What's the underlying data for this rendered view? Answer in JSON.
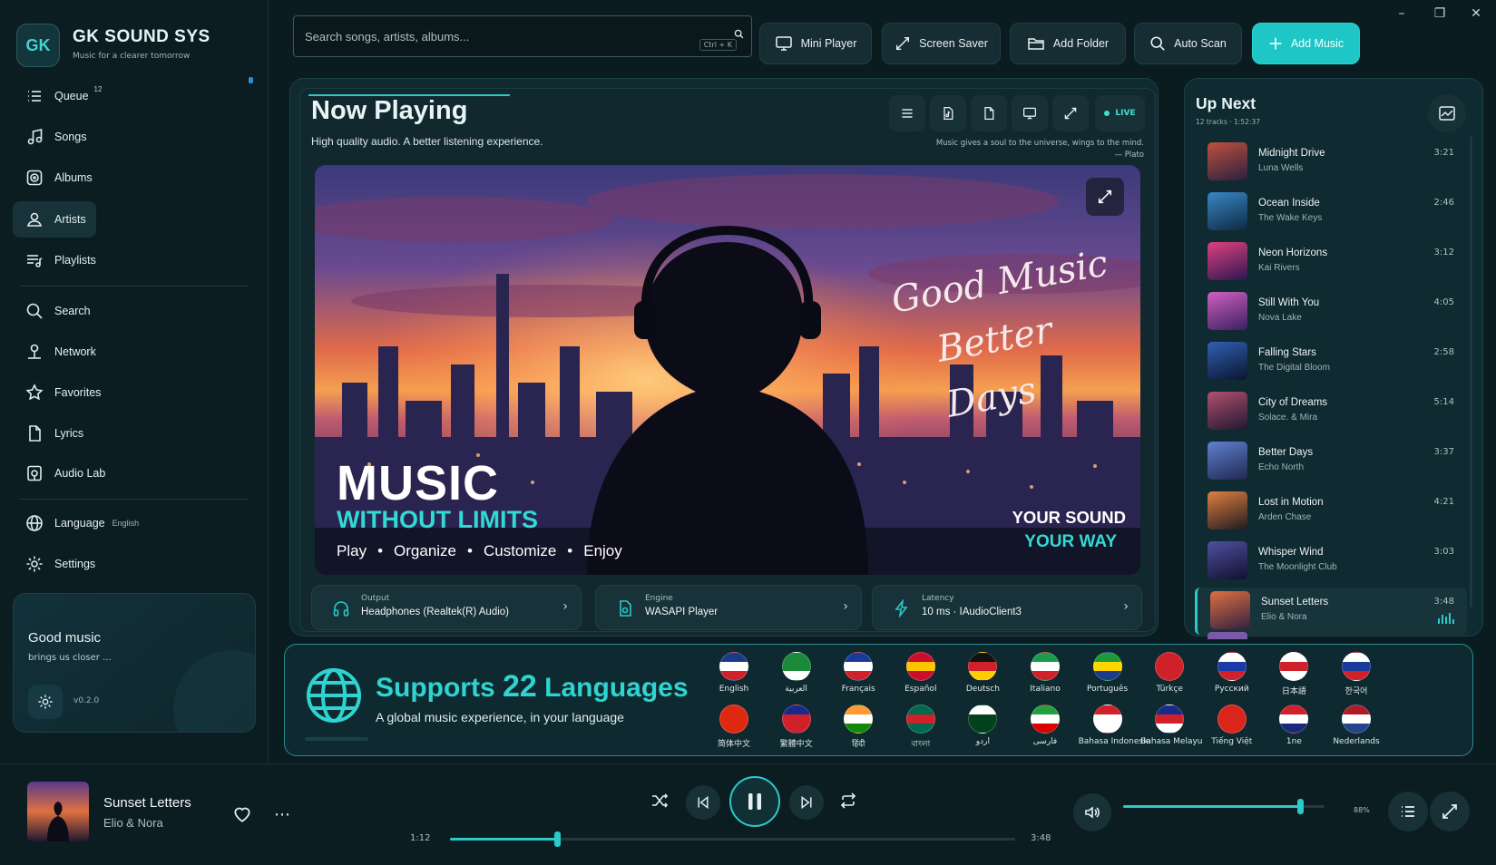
{
  "app": {
    "logo": "GK",
    "title": "GK SOUND SYS",
    "subtitle": "Music for a clearer tomorrow"
  },
  "window_controls": [
    "minimize-icon",
    "restore-icon",
    "close-icon"
  ],
  "sidebar": {
    "items": [
      {
        "label": "Queue",
        "badge": "12",
        "icon": "queue-list-icon"
      },
      {
        "label": "Songs",
        "icon": "music-note-icon"
      },
      {
        "label": "Albums",
        "icon": "album-icon"
      },
      {
        "label": "Artists",
        "icon": "user-icon",
        "active": true
      },
      {
        "label": "Playlists",
        "icon": "playlist-icon"
      },
      {
        "label": "Search",
        "icon": "search-icon"
      },
      {
        "label": "Network",
        "icon": "network-icon"
      },
      {
        "label": "Favorites",
        "icon": "star-icon"
      },
      {
        "label": "Lyrics",
        "icon": "document-icon"
      },
      {
        "label": "Audio Lab",
        "icon": "audio-lab-icon"
      },
      {
        "label": "Language",
        "sub": "English",
        "icon": "globe-icon"
      },
      {
        "label": "Settings",
        "icon": "gear-icon"
      }
    ],
    "promo": {
      "title": "Good music",
      "subtitle": "brings us closer ...",
      "version": "v0.2.0"
    }
  },
  "search": {
    "placeholder": "Search songs, artists, albums...",
    "shortcut": "Ctrl + K"
  },
  "toolbar": {
    "mini_player": "Mini Player",
    "screen_saver": "Screen Saver",
    "add_folder": "Add Folder",
    "auto_scan": "Auto Scan",
    "add_music": "Add Music"
  },
  "now_playing": {
    "title": "Now Playing",
    "subtitle": "High quality audio. A better listening experience.",
    "quote": "Music gives a soul to the universe, wings to the mind.",
    "quote_author": "— Plato",
    "live_label": "LIVE",
    "hero": {
      "script_line1": "Good Music",
      "script_line2": "Better Days",
      "headline": "MUSIC",
      "headline_sub": "WITHOUT LIMITS",
      "words": [
        "Play",
        "Organize",
        "Customize",
        "Enjoy"
      ],
      "right_line1": "YOUR SOUND",
      "right_line2": "YOUR WAY"
    },
    "output": {
      "label": "Output",
      "value": "Headphones (Realtek(R) Audio)"
    },
    "engine": {
      "label": "Engine",
      "value": "WASAPI Player"
    },
    "latency": {
      "label": "Latency",
      "value": "10 ms · IAudioClient3"
    }
  },
  "up_next": {
    "title": "Up Next",
    "subtitle": "12 tracks · 1:52:37",
    "tracks": [
      {
        "title": "Midnight Drive",
        "artist": "Luna Wells",
        "duration": "3:21",
        "color1": "#c0503c",
        "color2": "#2a2040"
      },
      {
        "title": "Ocean Inside",
        "artist": "The Wake Keys",
        "duration": "2:46",
        "color1": "#3a86c4",
        "color2": "#0d2a44"
      },
      {
        "title": "Neon Horizons",
        "artist": "Kai Rivers",
        "duration": "3:12",
        "color1": "#e04080",
        "color2": "#2a1850"
      },
      {
        "title": "Still With You",
        "artist": "Nova Lake",
        "duration": "4:05",
        "color1": "#d060c0",
        "color2": "#3a2060"
      },
      {
        "title": "Falling Stars",
        "artist": "The Digital Bloom",
        "duration": "2:58",
        "color1": "#3060b0",
        "color2": "#0a1530"
      },
      {
        "title": "City of Dreams",
        "artist": "Solace. & Mira",
        "duration": "5:14",
        "color1": "#b05070",
        "color2": "#201830"
      },
      {
        "title": "Better Days",
        "artist": "Echo North",
        "duration": "3:37",
        "color1": "#6080d0",
        "color2": "#202850"
      },
      {
        "title": "Lost in Motion",
        "artist": "Arden Chase",
        "duration": "4:21",
        "color1": "#e08040",
        "color2": "#201a20"
      },
      {
        "title": "Whisper Wind",
        "artist": "The Moonlight Club",
        "duration": "3:03",
        "color1": "#5050a0",
        "color2": "#101030"
      },
      {
        "title": "Sunset Letters",
        "artist": "Elio & Nora",
        "duration": "3:48",
        "color1": "#e07040",
        "color2": "#302040",
        "current": true
      }
    ]
  },
  "languages": {
    "title_pre": "Supports ",
    "title_num": "22",
    "title_post": " Languages",
    "subtitle": "A global music experience, in your language",
    "list": [
      {
        "name": "English",
        "flag": "uk-flag-icon",
        "colors": [
          "#1a3a8a",
          "#ffffff",
          "#d0202a"
        ]
      },
      {
        "name": "العربية",
        "flag": "saudi-flag-icon",
        "colors": [
          "#1a8a3a",
          "#1a8a3a",
          "#ffffff"
        ]
      },
      {
        "name": "Français",
        "flag": "france-flag-icon",
        "colors": [
          "#1a3a9a",
          "#ffffff",
          "#d0202a"
        ]
      },
      {
        "name": "Español",
        "flag": "spain-flag-icon",
        "colors": [
          "#c8102e",
          "#ffc400",
          "#c8102e"
        ]
      },
      {
        "name": "Deutsch",
        "flag": "germany-flag-icon",
        "colors": [
          "#111111",
          "#d0202a",
          "#ffce00"
        ]
      },
      {
        "name": "Italiano",
        "flag": "italy-flag-icon",
        "colors": [
          "#1a9a4a",
          "#ffffff",
          "#d0202a"
        ]
      },
      {
        "name": "Português",
        "flag": "brazil-flag-icon",
        "colors": [
          "#1a9a3a",
          "#ffd700",
          "#1a3a8a"
        ]
      },
      {
        "name": "Türkçe",
        "flag": "turkey-flag-icon",
        "colors": [
          "#d0202a",
          "#d0202a",
          "#d0202a"
        ]
      },
      {
        "name": "Русский",
        "flag": "russia-flag-icon",
        "colors": [
          "#ffffff",
          "#1a3aaa",
          "#d0202a"
        ]
      },
      {
        "name": "日本語",
        "flag": "japan-flag-icon",
        "colors": [
          "#ffffff",
          "#d0202a",
          "#ffffff"
        ]
      },
      {
        "name": "한국어",
        "flag": "korea-flag-icon",
        "colors": [
          "#ffffff",
          "#1a3a9a",
          "#d0202a"
        ]
      },
      {
        "name": "简体中文",
        "flag": "china-flag-icon",
        "colors": [
          "#de2910",
          "#de2910",
          "#de2910"
        ]
      },
      {
        "name": "繁體中文",
        "flag": "taiwan-flag-icon",
        "colors": [
          "#1a2a8a",
          "#d0202a",
          "#d0202a"
        ]
      },
      {
        "name": "हिंदी",
        "flag": "india-flag-icon",
        "colors": [
          "#ff9933",
          "#ffffff",
          "#138808"
        ]
      },
      {
        "name": "বাংলা",
        "flag": "bangladesh-flag-icon",
        "colors": [
          "#006a4e",
          "#d0202a",
          "#006a4e"
        ]
      },
      {
        "name": "اردو",
        "flag": "pakistan-flag-icon",
        "colors": [
          "#ffffff",
          "#01411c",
          "#01411c"
        ]
      },
      {
        "name": "فارسی",
        "flag": "iran-flag-icon",
        "colors": [
          "#239f40",
          "#ffffff",
          "#da0000"
        ]
      },
      {
        "name": "Bahasa Indonesie",
        "flag": "indonesia-flag-icon",
        "colors": [
          "#d0202a",
          "#ffffff",
          "#ffffff"
        ]
      },
      {
        "name": "Bahasa Melayu",
        "flag": "malaysia-flag-icon",
        "colors": [
          "#1a2a8a",
          "#d0202a",
          "#ffffff"
        ]
      },
      {
        "name": "Tiếng Việt",
        "flag": "vietnam-flag-icon",
        "colors": [
          "#da251d",
          "#da251d",
          "#da251d"
        ]
      },
      {
        "name": "1ne",
        "flag": "thailand-flag-icon",
        "colors": [
          "#d0202a",
          "#ffffff",
          "#1a2a7a"
        ]
      },
      {
        "name": "Nederlands",
        "flag": "netherlands-flag-icon",
        "colors": [
          "#ae1c28",
          "#ffffff",
          "#21468b"
        ]
      }
    ]
  },
  "player": {
    "title": "Sunset Letters",
    "artist": "Elio & Nora",
    "elapsed": "1:12",
    "duration": "3:48",
    "progress": 0.19,
    "volume": 0.88,
    "volume_label": "88%"
  },
  "colors": {
    "accent": "#2bc9c9",
    "background": "#0b1c21",
    "panel": "#0f2a30"
  }
}
